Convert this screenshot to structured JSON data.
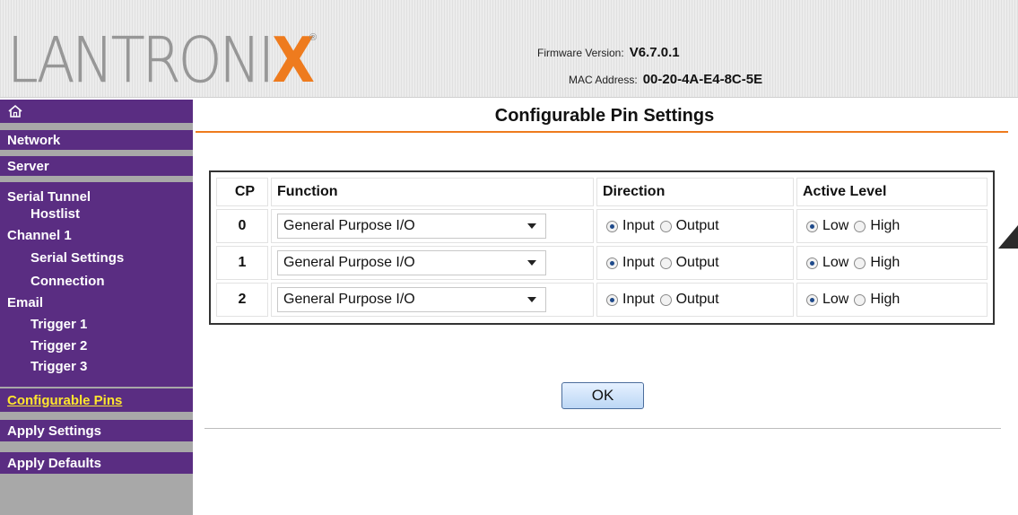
{
  "header": {
    "logo_text": "LANTRONI",
    "logo_x": "X",
    "logo_reg": "®",
    "firmware_label": "Firmware Version:",
    "firmware_value": "V6.7.0.1",
    "mac_label": "MAC Address:",
    "mac_value": "00-20-4A-E4-8C-5E"
  },
  "sidebar": {
    "home_icon": "home-icon",
    "network": "Network",
    "server": "Server",
    "serial_tunnel": "Serial Tunnel",
    "hostlist": "Hostlist",
    "channel_1": "Channel 1",
    "serial_settings": "Serial Settings",
    "connection": "Connection",
    "email": "Email",
    "trigger_1": "Trigger 1",
    "trigger_2": "Trigger 2",
    "trigger_3": "Trigger 3",
    "configurable_pins": "Configurable Pins",
    "apply_settings": "Apply Settings",
    "apply_defaults": "Apply Defaults"
  },
  "main": {
    "title": "Configurable Pin Settings",
    "columns": {
      "cp": "CP",
      "function": "Function",
      "direction": "Direction",
      "active_level": "Active Level"
    },
    "options": {
      "input": "Input",
      "output": "Output",
      "low": "Low",
      "high": "High"
    },
    "rows": [
      {
        "cp": "0",
        "function": "General Purpose I/O",
        "direction": "Input",
        "active_level": "Low"
      },
      {
        "cp": "1",
        "function": "General Purpose I/O",
        "direction": "Input",
        "active_level": "Low"
      },
      {
        "cp": "2",
        "function": "General Purpose I/O",
        "direction": "Input",
        "active_level": "Low"
      }
    ],
    "ok_label": "OK"
  },
  "colors": {
    "sidebar_purple": "#5a2d82",
    "accent_orange": "#ee7b1e",
    "active_link_yellow": "#ffe62e"
  }
}
